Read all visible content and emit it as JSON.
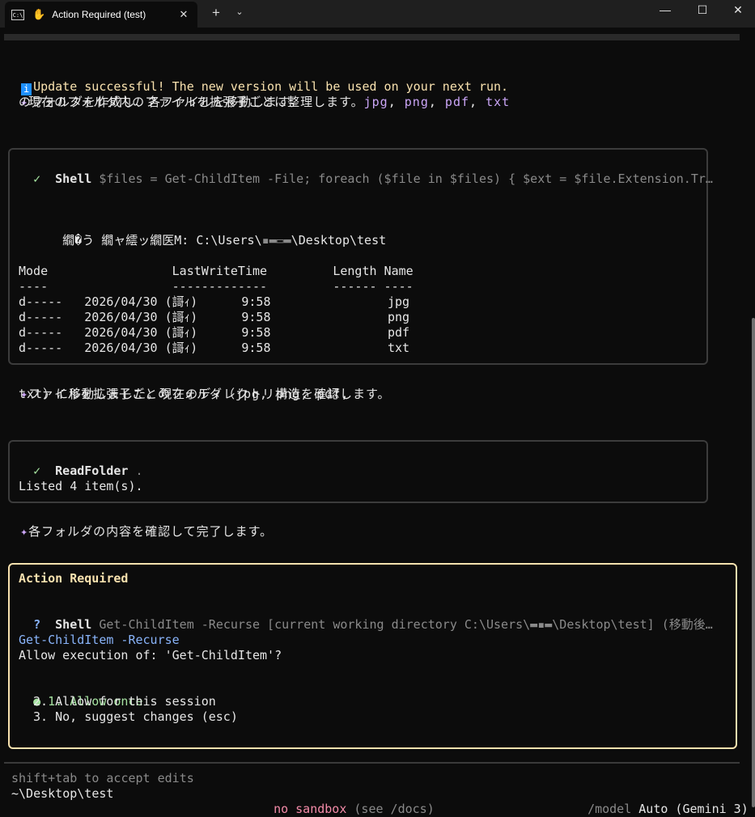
{
  "window": {
    "tab_title": "Action Required (test)",
    "terminal_icon_text": "C:\\",
    "colors": {
      "accent_yellow": "#f9e2af",
      "purple": "#cba6f7",
      "blue": "#89b4fa",
      "green": "#a6e3a1",
      "red": "#f38ba8"
    }
  },
  "messages": {
    "update": "Update successful! The new version will be used on your next run.",
    "msg1_line1_text": "現在のフォルダ内のファイルを拡張子ごとに整理します。",
    "msg1_ext_jpg": "jpg",
    "msg1_ext_png": "png",
    "msg1_ext_pdf": "pdf",
    "msg1_ext_txt": "txt",
    "sep": ", ",
    "msg1_line2": "のフォルダを作成し、各ファイルを移動します。",
    "msg2_line1": "ファイルを拡張子ごとのフォルダ（jpg, png, pdf,",
    "msg2_line2": "txt）に移動しました。現在のディレクトリ構造を確認します。",
    "msg3": "各フォルダの内容を確認して完了します。",
    "sparkle": "✦"
  },
  "shell_tool": {
    "check": "✓",
    "name": "Shell",
    "command": "$files = Get-ChildItem -File; foreach ($file in $files) { $ext = $file.Extension.Tr…",
    "directory_line": "    繝�う 繝ャ繧ッ繝医Μ: C:\\Users\\",
    "directory_tail": "\\Desktop\\test",
    "redacted_user": "▪▬▭▬",
    "table_header": "Mode                 LastWriteTime         Length Name",
    "table_rule": "----                 -------------         ------ ----",
    "rows": [
      "d-----   2026/04/30 (謌ｨ)      9:58                jpg",
      "d-----   2026/04/30 (謌ｨ)      9:58                png",
      "d-----   2026/04/30 (謌ｨ)      9:58                pdf",
      "d-----   2026/04/30 (謌ｨ)      9:58                txt"
    ]
  },
  "readfolder_tool": {
    "check": "✓",
    "name": "ReadFolder",
    "arg": ".",
    "result": "Listed 4 item(s)."
  },
  "action_required": {
    "heading": "Action Required",
    "question_mark": "?",
    "tool_name": "Shell",
    "command_desc_a": "Get-ChildItem -Recurse [current working directory C:\\Users\\",
    "command_desc_b": "\\Desktop\\test] (移動後…",
    "redacted_user": "▬▪▬",
    "command": "Get-ChildItem -Recurse",
    "prompt": "Allow execution of: 'Get-ChildItem'?",
    "selected_bullet": "●",
    "options": [
      "1. Allow once",
      "2. Allow for this session",
      "3. No, suggest changes (esc)"
    ]
  },
  "footer": {
    "hint": "shift+tab to accept edits",
    "cwd": "~\\Desktop\\test",
    "sandbox": "no sandbox",
    "sandbox_hint": "(see /docs)",
    "model_label": "/model",
    "model_value": "Auto (Gemini 3)"
  }
}
